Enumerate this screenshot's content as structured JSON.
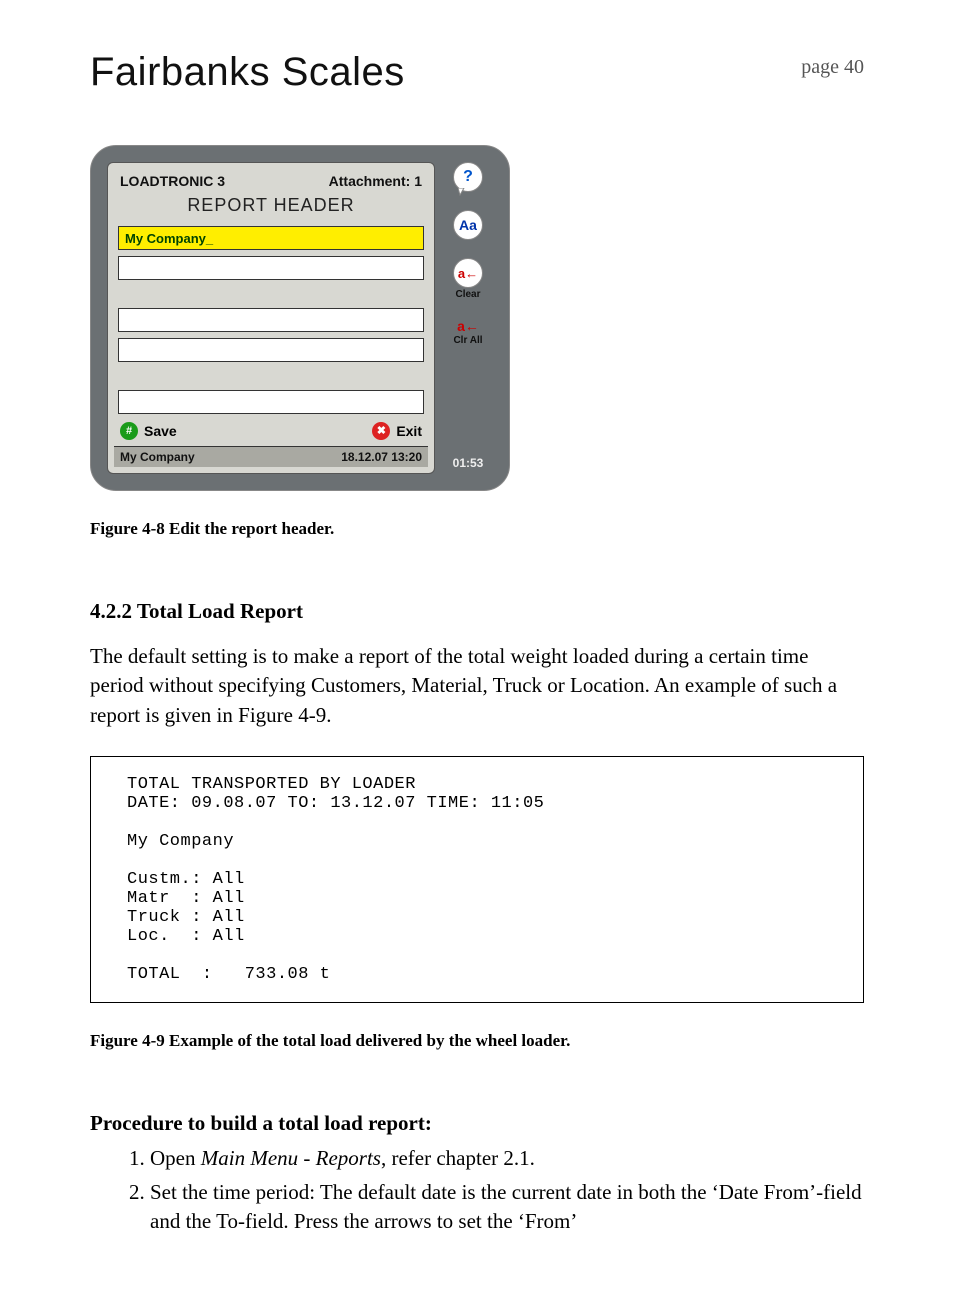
{
  "page": {
    "title": "Fairbanks Scales",
    "page_number": "page 40"
  },
  "device": {
    "product": "LOADTRONIC 3",
    "attachment": "Attachment: 1",
    "header_title": "REPORT HEADER",
    "fields": [
      {
        "value": "My Company_",
        "active": true
      },
      {
        "value": "",
        "active": false
      },
      {
        "value": "",
        "active": false
      },
      {
        "value": "",
        "active": false
      },
      {
        "value": "",
        "active": false
      }
    ],
    "save_label": "Save",
    "exit_label": "Exit",
    "status_left": "My Company",
    "status_right": "18.12.07 13:20",
    "side": {
      "help": {
        "symbol": "?",
        "label": ""
      },
      "keyboard": {
        "symbol": "Aa",
        "label": ""
      },
      "clear": {
        "symbol": "a←",
        "label": "Clear"
      },
      "clear_all": {
        "symbol": "a←",
        "label": "Clr All"
      }
    },
    "time": "01:53"
  },
  "caption1": "Figure 4-8 Edit the report header.",
  "section": {
    "heading": "4.2.2 Total Load Report",
    "body": "The default setting is to make a report of the total weight loaded during a certain time period without specifying Customers, Material, Truck or Location. An example of such a report is given in Figure 4-9."
  },
  "report": {
    "line1": "TOTAL TRANSPORTED BY LOADER",
    "line2": "DATE: 09.08.07 TO: 13.12.07 TIME: 11:05",
    "company": "My Company",
    "custm": "Custm.: All",
    "matr": "Matr  : All",
    "truck": "Truck : All",
    "loc": "Loc.  : All",
    "total": "TOTAL  :   733.08 t"
  },
  "caption2": "Figure 4-9 Example of the total load delivered by the wheel loader.",
  "procedure": {
    "heading": "Procedure to build a total load report:",
    "step1_prefix": "Open ",
    "step1_italic": "Main Menu - Reports",
    "step1_suffix": ", refer chapter 2.1.",
    "step2": "Set the time period: The default date is the current date in both the ‘Date From’-field and the To-field. Press the arrows to set the ‘From’"
  }
}
